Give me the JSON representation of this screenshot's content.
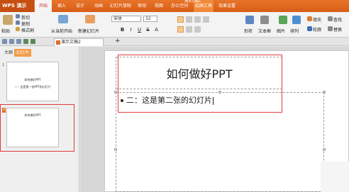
{
  "app": {
    "menu_label": "WPS 演示",
    "window_title": "演示文稿1"
  },
  "tabs": [
    {
      "label": "开始",
      "active": true
    },
    {
      "label": "插入",
      "active": false
    },
    {
      "label": "设计",
      "active": false
    },
    {
      "label": "动画",
      "active": false
    },
    {
      "label": "幻灯片放映",
      "active": false
    },
    {
      "label": "审阅",
      "active": false
    },
    {
      "label": "视图",
      "active": false
    },
    {
      "label": "办公空间",
      "active": false
    },
    {
      "label": "绘图工具",
      "active": false
    },
    {
      "label": "效果设置",
      "active": false
    }
  ],
  "ribbon": {
    "paste": "粘贴",
    "cut": "剪切",
    "copy": "复制",
    "format_painter": "格式刷",
    "from_current": "从当前开始",
    "new_slide": "新建幻灯片",
    "font_name": "宋体",
    "font_size": "32",
    "shape": "形状",
    "textbox": "文本框",
    "picture": "图片",
    "arrange": "排列",
    "fill": "填充",
    "outline": "轮廓",
    "find": "查找",
    "replace": "替换"
  },
  "panel": {
    "tab_outline": "大纲",
    "tab_slides": "幻灯片"
  },
  "doc_tab": "演示文稿2",
  "slides": [
    {
      "number": "1",
      "title": "如何做好PPT",
      "subtitle": "一：这是第一张PPT的幻灯片"
    },
    {
      "number": "2",
      "title": "如何做好PPT"
    }
  ],
  "current_slide": {
    "title": "如何做好PPT",
    "body": "二：这是第二张的幻灯片"
  },
  "colors": {
    "accent": "#e06c2c",
    "highlight_box": "#e03c3c"
  }
}
